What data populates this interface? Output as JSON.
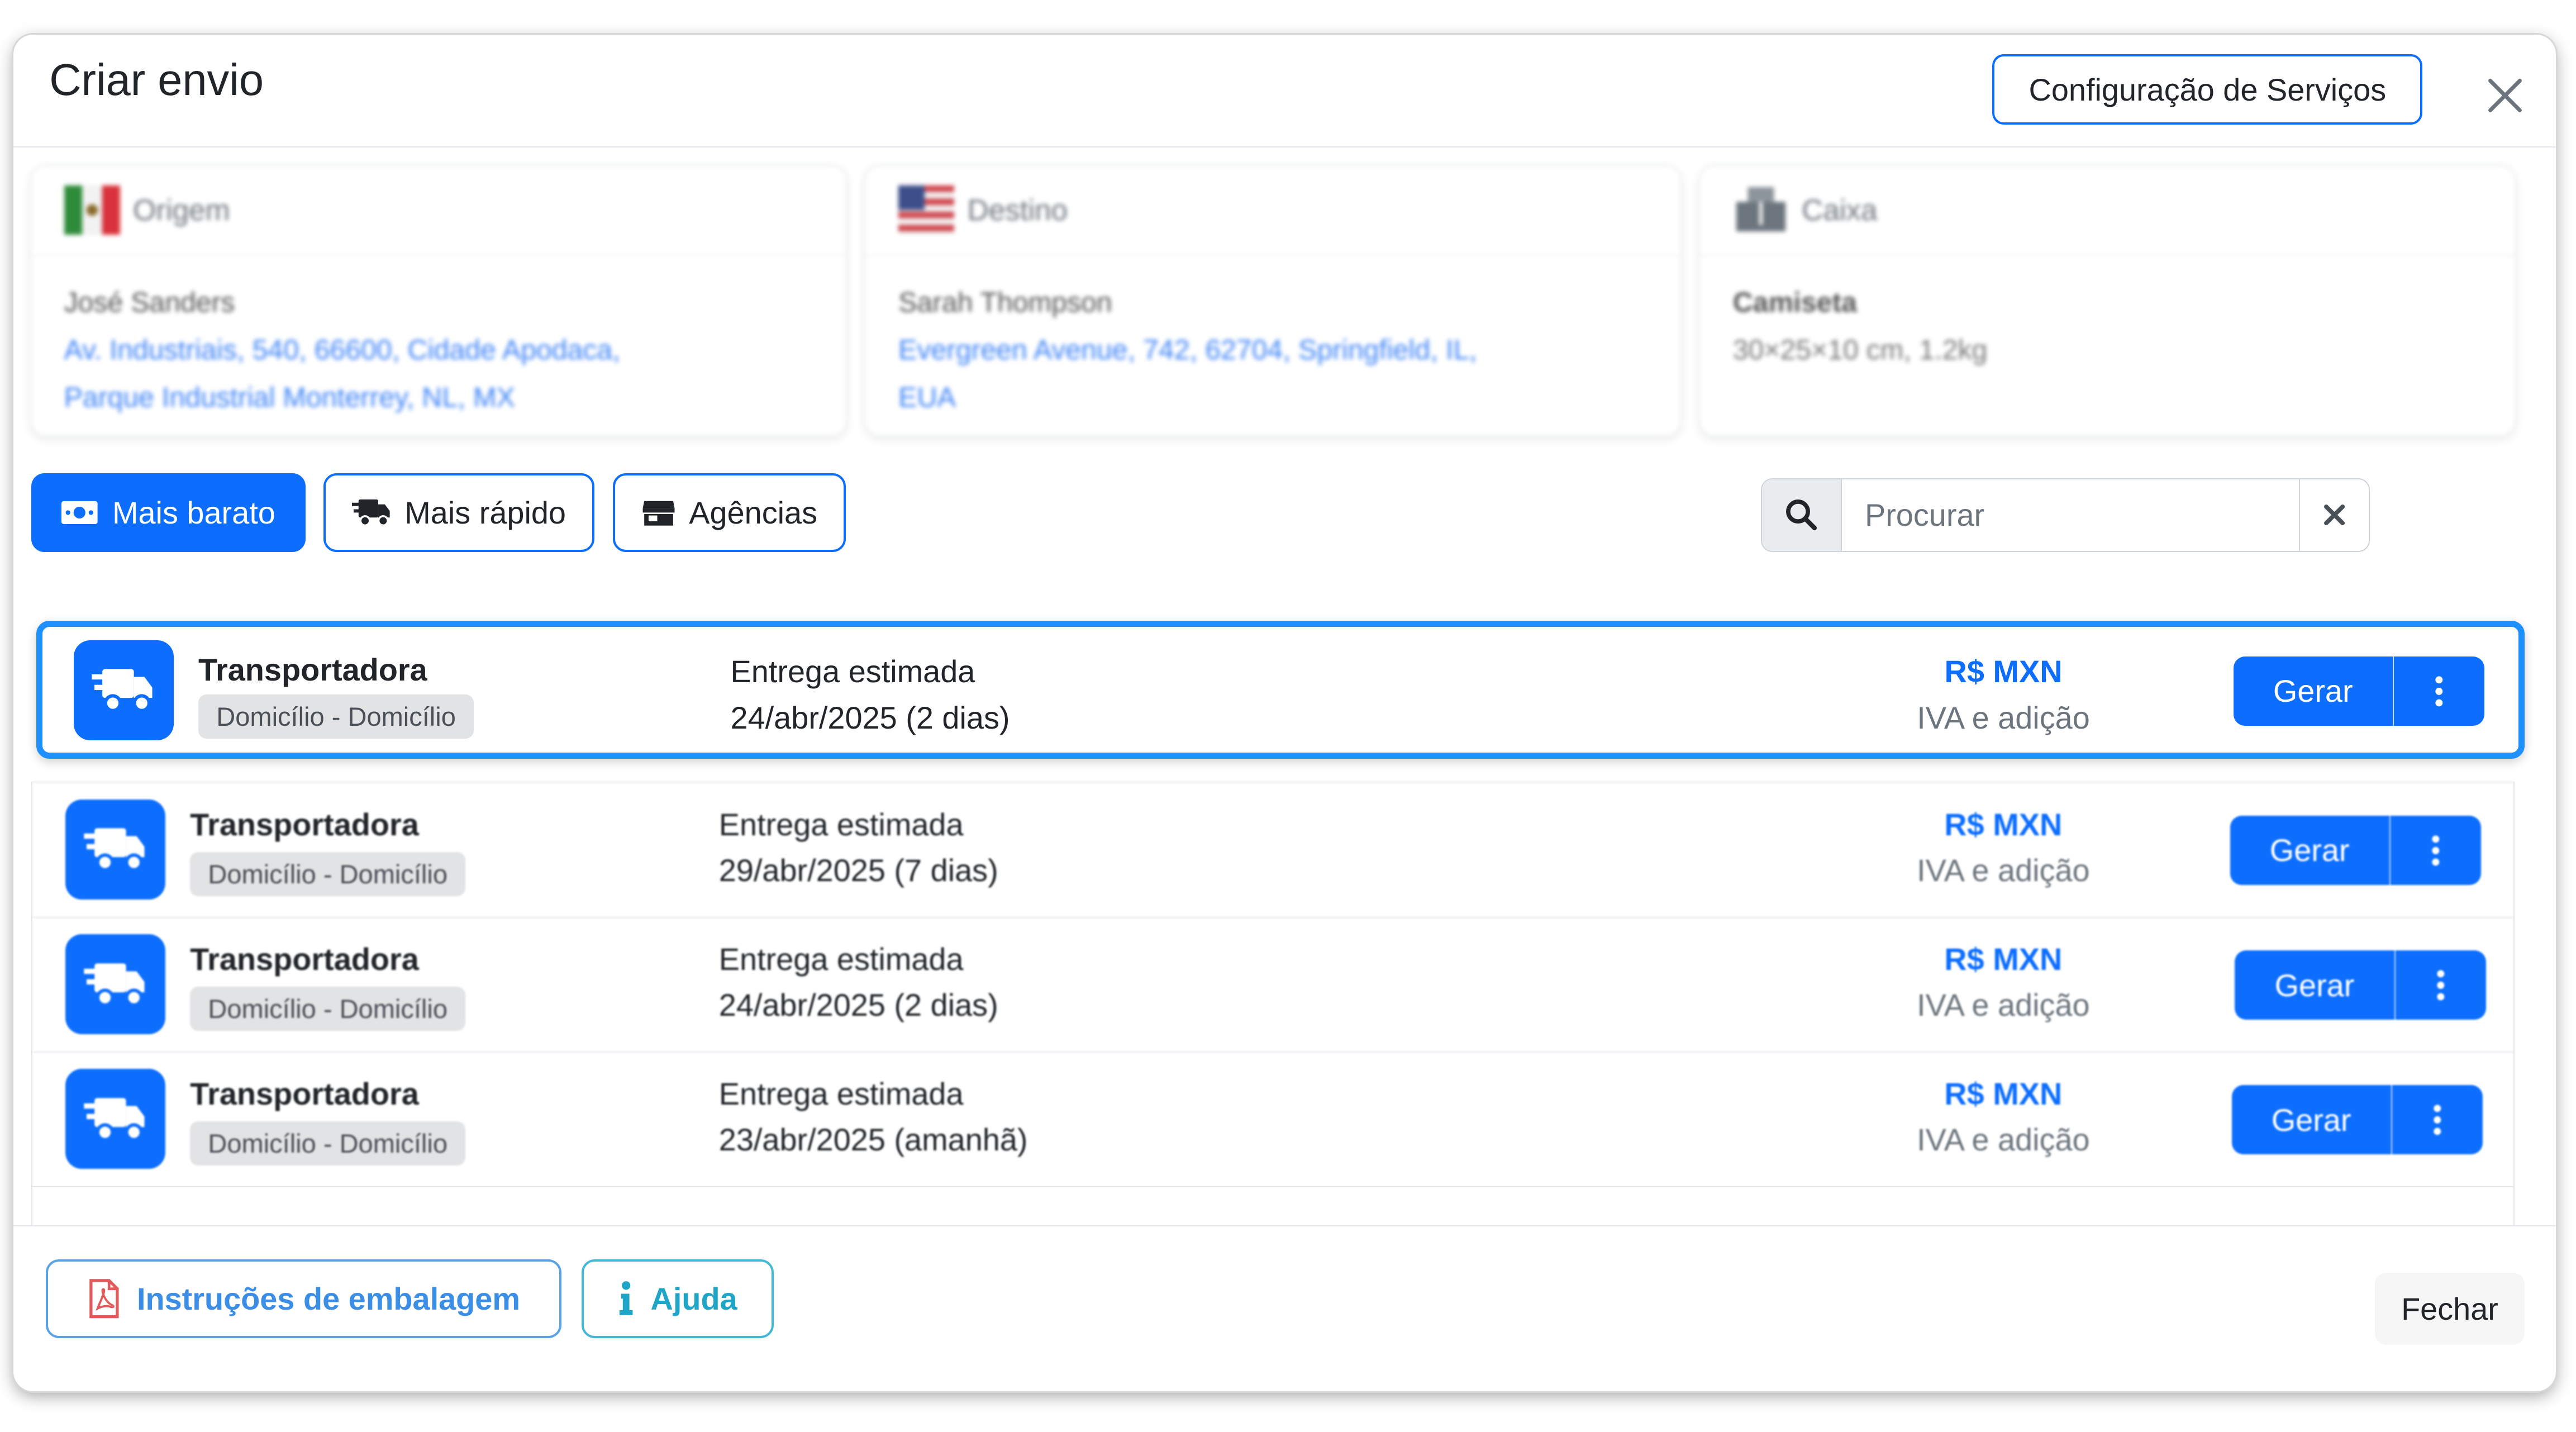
{
  "modal": {
    "title": "Criar envio",
    "config_button": "Configuração de Serviços"
  },
  "origin": {
    "heading": "Origem",
    "name": "José Sanders",
    "address_line1": "Av. Industriais, 540, 66600, Cidade Apodaca,",
    "address_line2": "Parque Industrial Monterrey, NL, MX"
  },
  "destination": {
    "heading": "Destino",
    "name": "Sarah Thompson",
    "address_line1": "Evergreen Avenue, 742, 62704, Springfield, IL,",
    "address_line2": "EUA"
  },
  "box": {
    "heading": "Caixa",
    "product": "Camiseta",
    "dimensions": "30×25×10 cm, 1.2kg"
  },
  "filters": [
    {
      "label": "Mais barato",
      "active": true
    },
    {
      "label": "Mais rápido",
      "active": false
    },
    {
      "label": "Agências",
      "active": false
    }
  ],
  "search": {
    "placeholder": "Procurar",
    "value": ""
  },
  "rates": [
    {
      "carrier": "Transportadora",
      "service": "Domicílio - Domicílio",
      "eta_label": "Entrega estimada",
      "eta": "24/abr/2025 (2 dias)",
      "price": "R$ MXN",
      "price_note": "IVA e adição",
      "action": "Gerar",
      "selected": true
    },
    {
      "carrier": "Transportadora",
      "service": "Domicílio - Domicílio",
      "eta_label": "Entrega estimada",
      "eta": "29/abr/2025 (7 dias)",
      "price": "R$ MXN",
      "price_note": "IVA e adição",
      "action": "Gerar",
      "selected": false
    },
    {
      "carrier": "Transportadora",
      "service": "Domicílio - Domicílio",
      "eta_label": "Entrega estimada",
      "eta": "24/abr/2025 (2 dias)",
      "price": "R$ MXN",
      "price_note": "IVA e adição",
      "action": "Gerar",
      "selected": false
    },
    {
      "carrier": "Transportadora",
      "service": "Domicílio - Domicílio",
      "eta_label": "Entrega estimada",
      "eta": "23/abr/2025 (amanhã)",
      "price": "R$ MXN",
      "price_note": "IVA e adição",
      "action": "Gerar",
      "selected": false
    }
  ],
  "footer": {
    "packing_button": "Instruções de embalagem",
    "help_button": "Ajuda",
    "close_button": "Fechar"
  },
  "colors": {
    "primary": "#0d6efd",
    "selected_border": "#1e90ff",
    "price": "#0d6efd",
    "help": "#1fa5c8",
    "pdf_icon": "#e05a5a"
  },
  "icons": {
    "filter_cheapest": "money-bill-icon",
    "filter_fastest": "shipping-fast-icon",
    "filter_agencies": "store-icon",
    "carrier": "shipping-fast-icon",
    "packing": "file-pdf-icon",
    "help": "info-icon"
  }
}
